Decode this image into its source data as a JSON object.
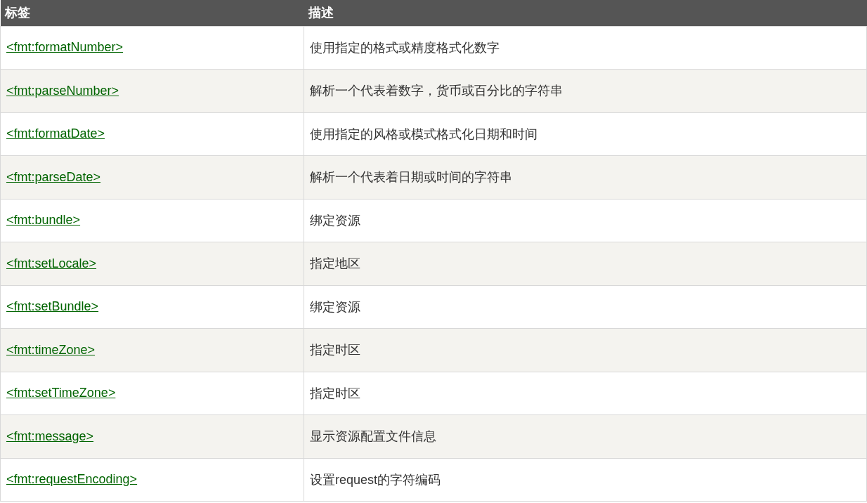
{
  "table": {
    "columns": [
      "标签",
      "描述"
    ],
    "rows": [
      {
        "tag": "<fmt:formatNumber>",
        "description": "使用指定的格式或精度格式化数字"
      },
      {
        "tag": "<fmt:parseNumber>",
        "description": "解析一个代表着数字，货币或百分比的字符串"
      },
      {
        "tag": "<fmt:formatDate>",
        "description": "使用指定的风格或模式格式化日期和时间"
      },
      {
        "tag": "<fmt:parseDate>",
        "description": "解析一个代表着日期或时间的字符串"
      },
      {
        "tag": "<fmt:bundle>",
        "description": "绑定资源"
      },
      {
        "tag": "<fmt:setLocale>",
        "description": "指定地区"
      },
      {
        "tag": "<fmt:setBundle>",
        "description": "绑定资源"
      },
      {
        "tag": "<fmt:timeZone>",
        "description": "指定时区"
      },
      {
        "tag": "<fmt:setTimeZone>",
        "description": "指定时区"
      },
      {
        "tag": "<fmt:message>",
        "description": "显示资源配置文件信息"
      },
      {
        "tag": "<fmt:requestEncoding>",
        "description": "设置request的字符编码"
      }
    ]
  }
}
